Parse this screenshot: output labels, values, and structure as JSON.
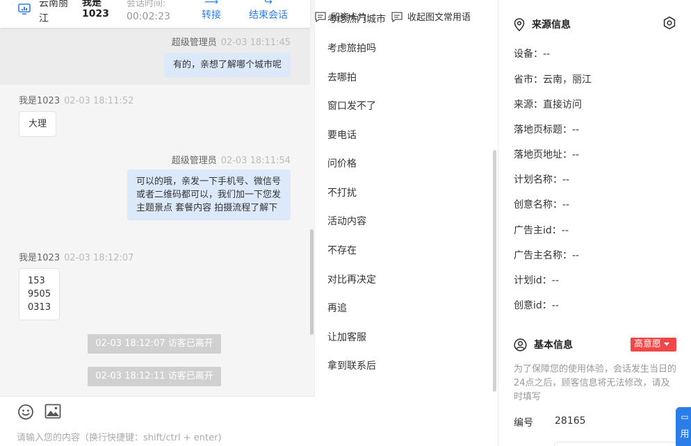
{
  "header": {
    "region": "云南丽江",
    "visitor": "我是1023",
    "session_label": "会话时间:",
    "session_time": "00:02:23",
    "transfer_label": "转接",
    "end_label": "结束会话"
  },
  "messages": [
    {
      "role": "agent",
      "sender": "超级管理员",
      "time": "02-03 18:11:45",
      "text": "有的，亲想了解哪个城市呢"
    },
    {
      "role": "visitor",
      "sender": "我是1023",
      "time": "02-03 18:11:52",
      "text": "大理"
    },
    {
      "role": "agent",
      "sender": "超级管理员",
      "time": "02-03 18:11:54",
      "text": "可以的哦，亲发一下手机号、微信号或者二维码都可以，我们加一下您发主题景点 套餐内容 拍摄流程了解下"
    },
    {
      "role": "visitor",
      "sender": "我是1023",
      "time": "02-03 18:12:07",
      "text": "153 9505 0313"
    }
  ],
  "system_notes": [
    "02-03 18:12:07 访客已离开",
    "02-03 18:12:11 访客已离开"
  ],
  "composer": {
    "card_label": "留资卡片",
    "phrase_label": "收起图文常用语",
    "placeholder": "请输入您的内容（换行快捷键：shift/ctrl + enter)"
  },
  "quick_replies": [
    "考虑热门城市",
    "考虑旅拍吗",
    "去哪拍",
    "窗口发不了",
    "要电话",
    "问价格",
    "不打扰",
    "活动内容",
    "不存在",
    "对比再决定",
    "再追",
    "让加客服",
    "拿到联系后"
  ],
  "source_info": {
    "title": "来源信息",
    "rows": [
      "设备：--",
      "省市：云南，丽江",
      "来源：直接访问",
      "落地页标题：--",
      "落地页地址：--",
      "计划名称：--",
      "创意名称：--",
      "广告主id：--",
      "广告主名称：--",
      "计划id：--",
      "创意id：--"
    ]
  },
  "basic_info": {
    "title": "基本信息",
    "intent": "高意愿",
    "notice": "为了保障您的使用体验，会话发生当日的24点之后，顾客信息将无法修改，请及时填写",
    "number_label": "编号",
    "number_value": "28165"
  },
  "float_label": "用",
  "colors": {
    "accent": "#2b7de9",
    "agent_bubble": "#dce9fb",
    "intent_badge": "#f04848"
  },
  "icons": [
    "monitor-icon",
    "transfer-icon",
    "exit-icon",
    "emoji-icon",
    "image-icon",
    "card-icon",
    "phrase-icon",
    "location-pin-icon",
    "settings-icon",
    "user-circle-icon",
    "chat-icon"
  ]
}
